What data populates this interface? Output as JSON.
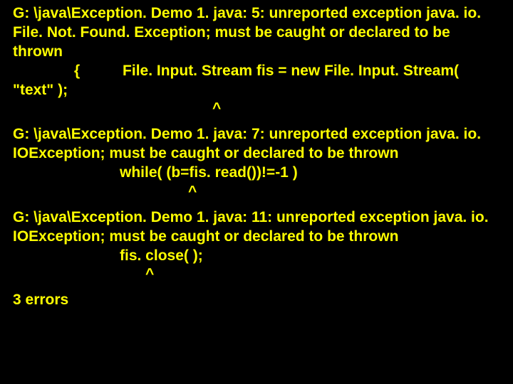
{
  "errors": [
    {
      "message": "G: \\java\\Exception. Demo 1. java: 5: unreported exception java. io. File. Not. Found. Exception; must be caught or declared to be thrown",
      "code_brace": "{",
      "code_stmt": "File. Input. Stream fis = new File. Input. Stream(",
      "code_cont": "\"text\" );",
      "caret": "^"
    },
    {
      "message": "G: \\java\\Exception. Demo 1. java: 7: unreported exception java. io. IOException; must be caught or declared to be thrown",
      "code_stmt": "while( (b=fis. read())!=-1 )",
      "caret": "^"
    },
    {
      "message": "G: \\java\\Exception. Demo 1. java: 11: unreported exception java. io. IOException; must be caught or declared to be thrown",
      "code_stmt": "fis. close( );",
      "caret": "^"
    }
  ],
  "summary": "3 errors"
}
